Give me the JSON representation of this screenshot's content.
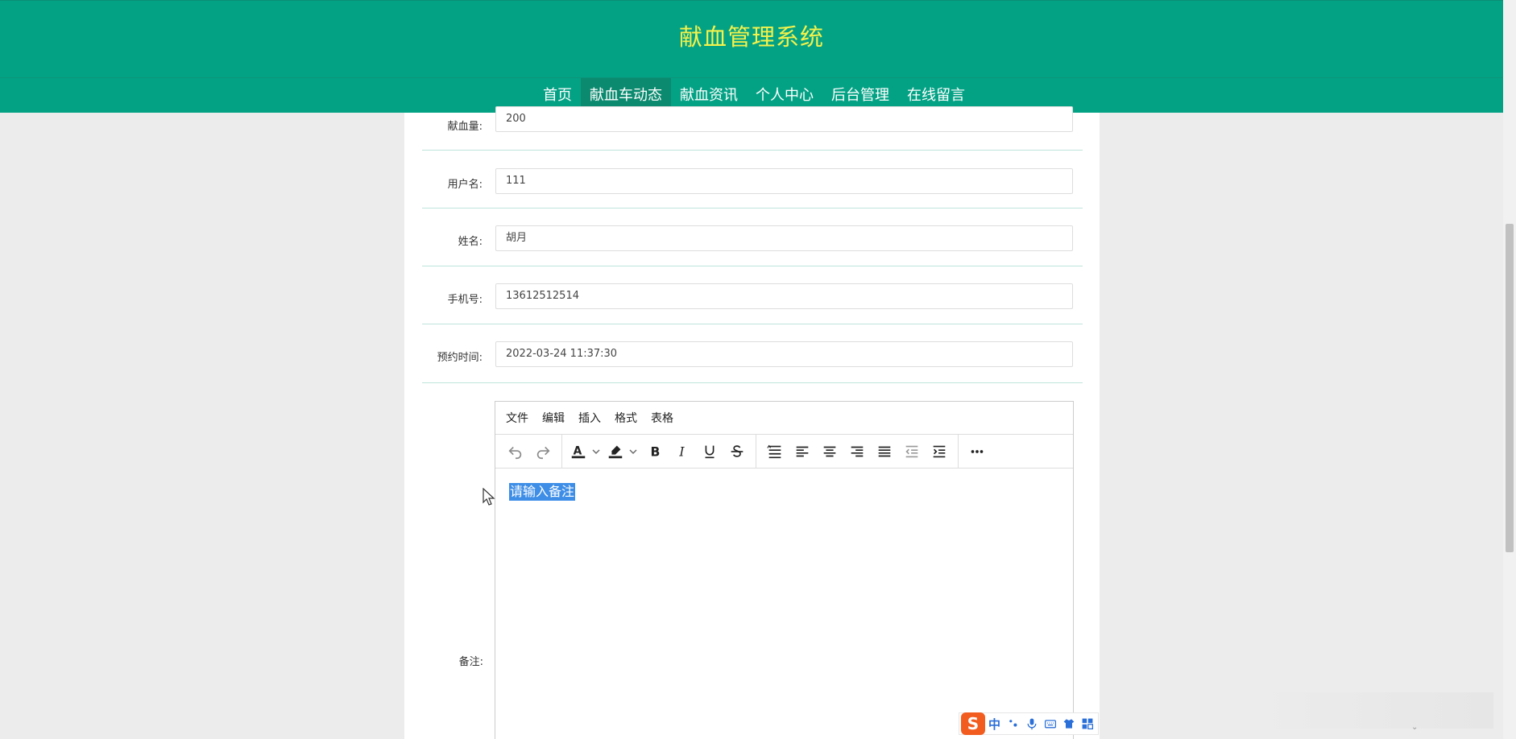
{
  "site": {
    "title": "献血管理系统"
  },
  "nav": {
    "items": [
      {
        "label": "首页"
      },
      {
        "label": "献血车动态"
      },
      {
        "label": "献血资讯"
      },
      {
        "label": "个人中心"
      },
      {
        "label": "后台管理"
      },
      {
        "label": "在线留言"
      }
    ],
    "active_index": 1
  },
  "form": {
    "fields": [
      {
        "label": "献血量:",
        "value": "200"
      },
      {
        "label": "用户名:",
        "value": "111"
      },
      {
        "label": "姓名:",
        "value": "胡月"
      },
      {
        "label": "手机号:",
        "value": "13612512514"
      },
      {
        "label": "预约时间:",
        "value": "2022-03-24 11:37:30"
      }
    ],
    "remark": {
      "label": "备注:",
      "placeholder": "请输入备注"
    }
  },
  "editor": {
    "menu": [
      "文件",
      "编辑",
      "插入",
      "格式",
      "表格"
    ],
    "toolbar_icons": [
      "undo-icon",
      "redo-icon",
      "text-color-icon",
      "highlight-color-icon",
      "bold-icon",
      "italic-icon",
      "underline-icon",
      "strikethrough-icon",
      "line-height-icon",
      "align-left-icon",
      "align-center-icon",
      "align-right-icon",
      "align-justify-icon",
      "outdent-icon",
      "indent-icon",
      "more-icon"
    ]
  },
  "ime": {
    "mode_label": "中"
  },
  "colors": {
    "header_bg": "#04a285",
    "nav_active_bg": "#0b8a6f",
    "title_color": "#f5f24a",
    "selection": "#3e8ee7",
    "row_border": "#bfe5dc"
  }
}
